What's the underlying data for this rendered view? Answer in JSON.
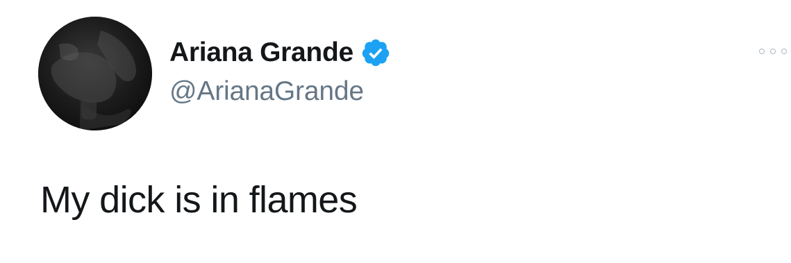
{
  "tweet": {
    "author": {
      "display_name": "Ariana Grande",
      "handle": "@ArianaGrande",
      "verified": true,
      "verified_icon": "verified-badge-icon",
      "avatar": "profile-photo"
    },
    "text": "My dick is in flames",
    "menu_icon": "more-options-icon"
  },
  "colors": {
    "name": "#14171a",
    "handle": "#657786",
    "verified": "#1da1f2",
    "menu": "#aab8c2",
    "background": "#ffffff"
  }
}
